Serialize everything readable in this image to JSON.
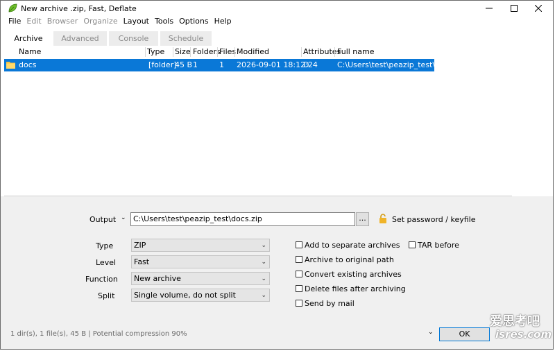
{
  "window": {
    "title": "New archive .zip, Fast, Deflate"
  },
  "menu": {
    "items": [
      "File",
      "Edit",
      "Browser",
      "Organize",
      "Layout",
      "Tools",
      "Options",
      "Help"
    ]
  },
  "tabs": [
    {
      "label": "Archive",
      "active": true
    },
    {
      "label": "Advanced",
      "active": false
    },
    {
      "label": "Console",
      "active": false
    },
    {
      "label": "Schedule",
      "active": false
    }
  ],
  "list": {
    "columns": [
      "Name",
      "Type",
      "Size",
      "Folders",
      "Files",
      "Modified",
      "Attributes",
      "Full name"
    ],
    "rows": [
      {
        "name": "docs",
        "type": "[folder]",
        "size": "45 B",
        "folders": "1",
        "files": "1",
        "modified": "2026-09-01 18:12:24",
        "attributes": "D",
        "fullname": "C:\\Users\\test\\peazip_test\\docs"
      }
    ]
  },
  "output": {
    "label": "Output",
    "value": "C:\\Users\\test\\peazip_test\\docs.zip",
    "browse": "...",
    "password_label": "Set password / keyfile"
  },
  "options": {
    "type": {
      "label": "Type",
      "value": "ZIP"
    },
    "level": {
      "label": "Level",
      "value": "Fast"
    },
    "function": {
      "label": "Function",
      "value": "New archive"
    },
    "split": {
      "label": "Split",
      "value": "Single volume, do not split"
    }
  },
  "checkboxes": {
    "separate": "Add to separate archives",
    "original_path": "Archive to original path",
    "convert": "Convert existing archives",
    "delete": "Delete files after archiving",
    "mail": "Send by mail",
    "tar": "TAR before"
  },
  "status": "1 dir(s), 1 file(s), 45 B | Potential compression 90%",
  "ok_label": "OK",
  "watermark": {
    "line1": "爱思考吧",
    "line2": "isres.com"
  },
  "colors": {
    "selection": "#0a78d7",
    "pane": "#f0f0f0"
  }
}
